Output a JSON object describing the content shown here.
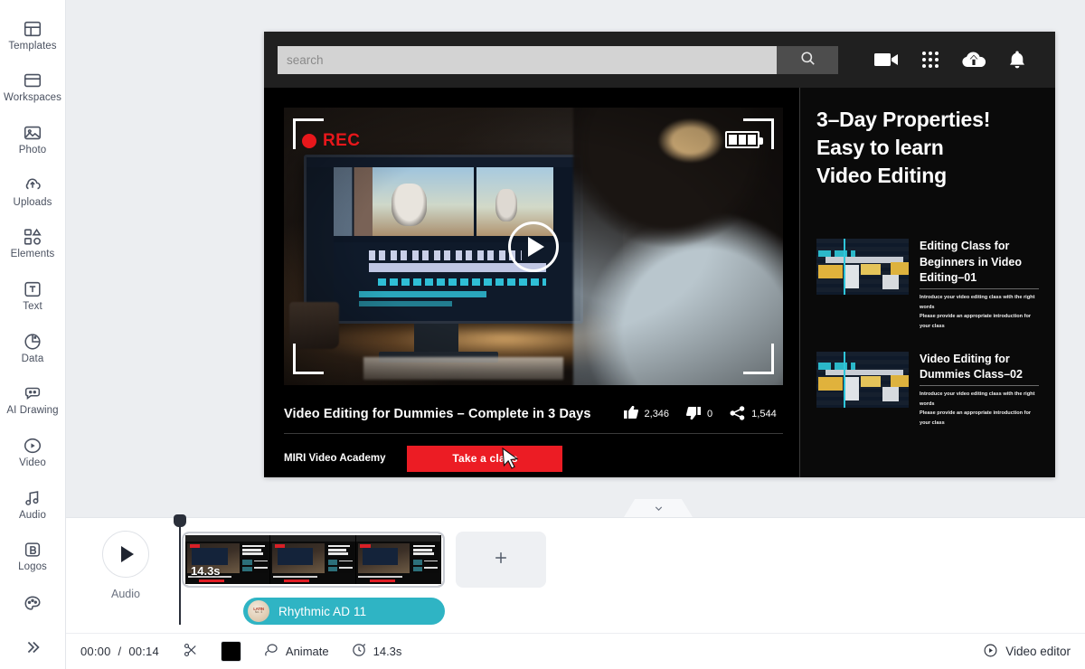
{
  "sidebar": {
    "items": [
      {
        "label": "Templates",
        "icon": "templates-icon"
      },
      {
        "label": "Workspaces",
        "icon": "workspaces-icon"
      },
      {
        "label": "Photo",
        "icon": "photo-icon"
      },
      {
        "label": "Uploads",
        "icon": "uploads-icon"
      },
      {
        "label": "Elements",
        "icon": "elements-icon"
      },
      {
        "label": "Text",
        "icon": "text-icon"
      },
      {
        "label": "Data",
        "icon": "data-icon"
      },
      {
        "label": "AI Drawing",
        "icon": "ai-drawing-icon"
      },
      {
        "label": "Video",
        "icon": "video-icon"
      },
      {
        "label": "Audio",
        "icon": "audio-icon"
      },
      {
        "label": "Logos",
        "icon": "logos-icon"
      }
    ],
    "palette_icon": "palette-icon",
    "expand_icon": "double-chevron-right-icon"
  },
  "canvas": {
    "topbar": {
      "search_placeholder": "search",
      "search_value": "",
      "search_icon": "search-icon",
      "icons": [
        "video-camera-icon",
        "apps-grid-icon",
        "upload-cloud-icon",
        "bell-icon"
      ]
    },
    "video": {
      "rec_label": "REC",
      "rec_dot": "record-dot-icon",
      "battery_icon": "battery-icon",
      "play_icon": "play-icon",
      "title": "Video Editing for Dummies – Complete in 3 Days",
      "likes": "2,346",
      "dislikes": "0",
      "shares": "1,544",
      "like_icon": "thumbs-up-icon",
      "dislike_icon": "thumbs-down-icon",
      "share_icon": "share-icon",
      "channel": "MIRI Video Academy",
      "cta_label": "Take a class",
      "cursor_icon": "mouse-cursor-icon"
    },
    "panel": {
      "headline_lines": [
        "3–Day Properties!",
        "Easy to learn",
        "Video Editing"
      ],
      "cards": [
        {
          "title": "Editing Class for Beginners in Video Editing–01",
          "sub1": "Introduce your video editing class with the right words",
          "sub2": "Please provide an appropriate introduction for your class"
        },
        {
          "title": "Video Editing for Dummies Class–02",
          "sub1": "Introduce your video editing class with the right words",
          "sub2": "Please provide an appropriate introduction for your class"
        }
      ]
    },
    "collapse_icon": "chevron-down-icon"
  },
  "timeline": {
    "audio_button_label": "Audio",
    "audio_play_icon": "play-icon",
    "clip_duration": "14.3s",
    "add_icon": "plus-icon",
    "audio_track_name": "Rhythmic AD 11",
    "audio_track_color": "#2fb4c4",
    "playhead_position": "00:00",
    "bottom": {
      "current_time": "00:00",
      "separator": "/",
      "total_time": "00:14",
      "scissors_icon": "scissors-icon",
      "color_swatch": "#000000",
      "animate_label": "Animate",
      "animate_icon": "animate-icon",
      "duration_label": "14.3s",
      "duration_icon": "clock-icon",
      "video_editor_label": "Video editor",
      "video_editor_icon": "play-circle-icon"
    }
  }
}
